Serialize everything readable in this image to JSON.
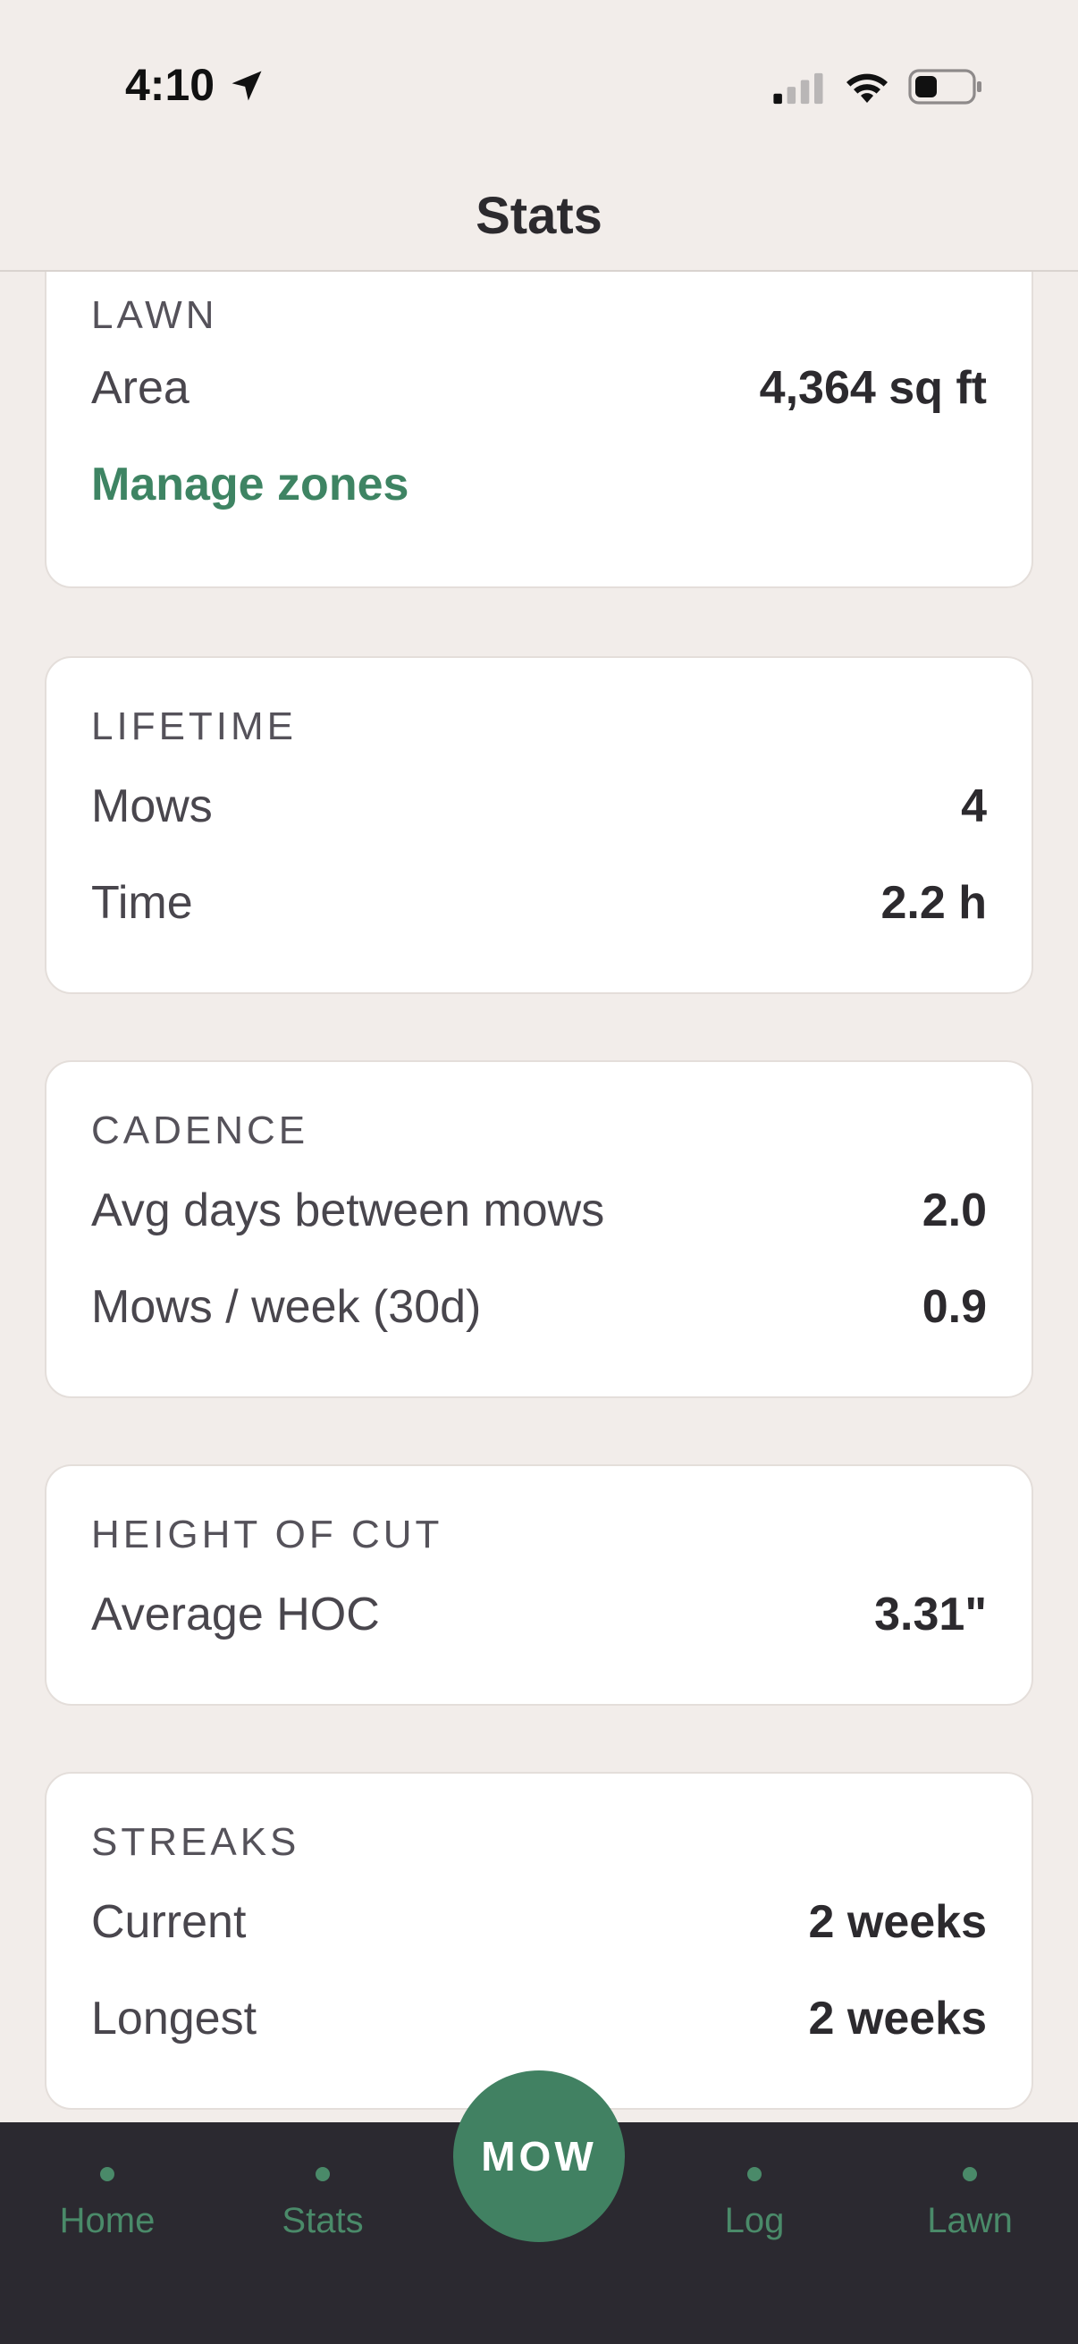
{
  "status_bar": {
    "time": "4:10",
    "icons": [
      "location-arrow-icon",
      "cellular-signal-icon",
      "wifi-icon",
      "battery-icon"
    ]
  },
  "header": {
    "title": "Stats"
  },
  "cards": {
    "lawn": {
      "heading": "LAWN",
      "area_label": "Area",
      "area_value": "4,364 sq ft",
      "link_label": "Manage zones"
    },
    "lifetime": {
      "heading": "LIFETIME",
      "mows_label": "Mows",
      "mows_value": "4",
      "time_label": "Time",
      "time_value": "2.2 h"
    },
    "cadence": {
      "heading": "CADENCE",
      "avg_label": "Avg days between mows",
      "avg_value": "2.0",
      "per_week_label": "Mows / week (30d)",
      "per_week_value": "0.9"
    },
    "hoc": {
      "heading": "HEIGHT OF CUT",
      "avg_label": "Average HOC",
      "avg_value": "3.31\""
    },
    "streaks": {
      "heading": "STREAKS",
      "current_label": "Current",
      "current_value": "2 weeks",
      "longest_label": "Longest",
      "longest_value": "2 weeks"
    }
  },
  "tab_bar": {
    "home": "Home",
    "stats": "Stats",
    "mow": "MOW",
    "log": "Log",
    "lawn": "Lawn"
  },
  "colors": {
    "background": "#f2edea",
    "accent": "#418162",
    "link": "#3e8463",
    "tab_bar": "#2b2930"
  }
}
